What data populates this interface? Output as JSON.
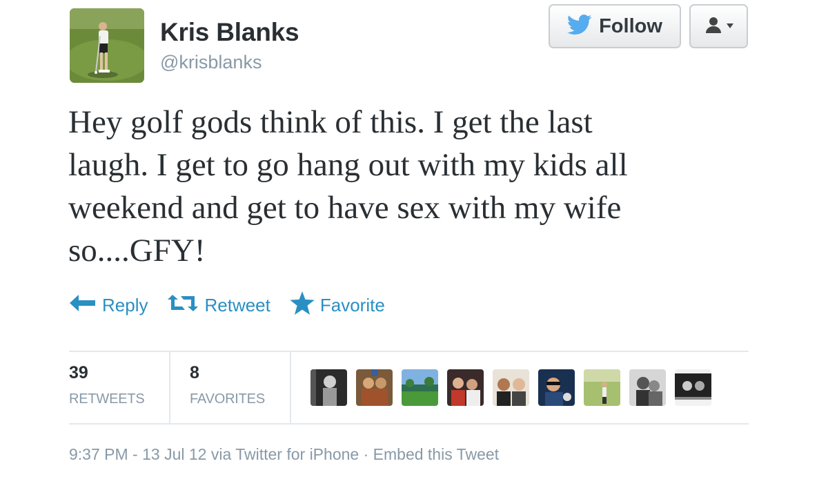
{
  "user": {
    "name": "Kris Blanks",
    "screen_name": "@krisblanks"
  },
  "follow_button": {
    "label": "Follow",
    "icon": "twitter-bird-icon"
  },
  "user_menu": {
    "icon": "user-dropdown-icon"
  },
  "tweet": {
    "lines": [
      "Hey golf gods think of this. I get the last",
      "laugh. I get to go hang out with my kids all",
      "weekend and get to have sex with my wife",
      "so....GFY!"
    ]
  },
  "actions": {
    "reply": "Reply",
    "retweet": "Retweet",
    "favorite": "Favorite"
  },
  "stats": {
    "retweets": {
      "count": "39",
      "label": "RETWEETS"
    },
    "favorites": {
      "count": "8",
      "label": "FAVORITES"
    }
  },
  "meta": {
    "timestamp": "9:37 PM - 13 Jul 12",
    "via": "via Twitter for iPhone",
    "separator": "·",
    "embed": "Embed this Tweet"
  },
  "colors": {
    "link": "#2a8fc3",
    "twitter_blue": "#55acee",
    "muted": "#8899a6",
    "text": "#292f33"
  }
}
